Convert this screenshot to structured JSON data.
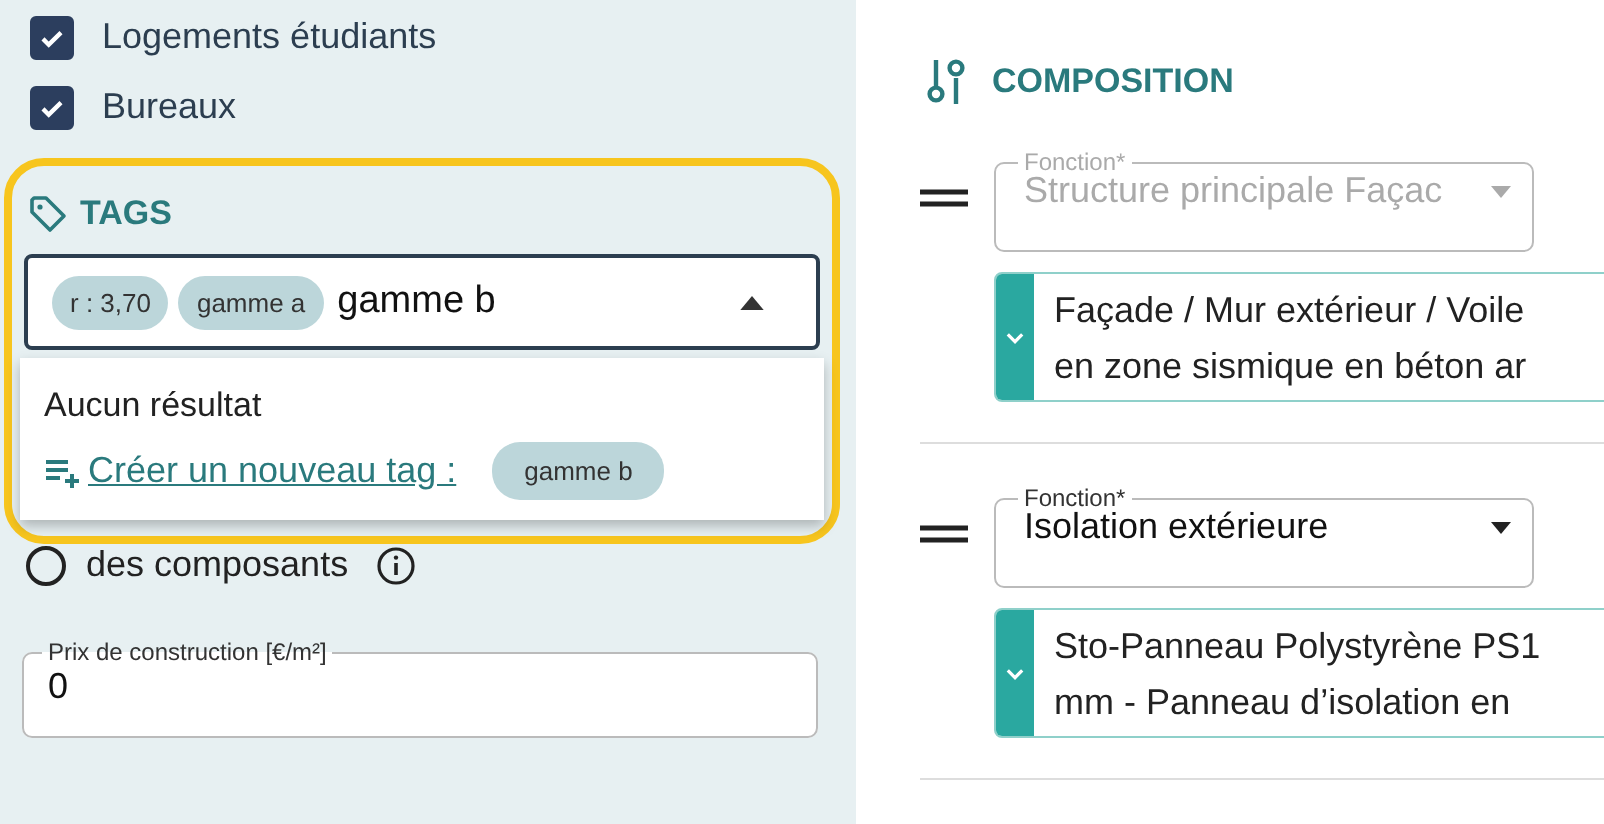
{
  "sidebar": {
    "checkboxes": [
      {
        "label": "Logements étudiants",
        "checked": true
      },
      {
        "label": "Bureaux",
        "checked": true
      }
    ],
    "tags": {
      "title": "TAGS",
      "chips": [
        "r : 3,70",
        "gamme a"
      ],
      "value": "gamme b",
      "expanded": true,
      "menu": {
        "empty_text": "Aucun résultat",
        "create_link": "Créer un nouveau tag :",
        "create_chip": "gamme b"
      }
    },
    "radio": {
      "label": "des composants",
      "selected": false
    },
    "price": {
      "label": "Prix de construction [€/m²]",
      "value": "0"
    }
  },
  "composition": {
    "title": "COMPOSITION",
    "rows": [
      {
        "field": {
          "label": "Fonction*",
          "value": "Structure principale Façac",
          "disabled": true
        },
        "card": {
          "lines": [
            "Façade / Mur extérieur / Voile",
            "en zone sismique en béton ar"
          ]
        }
      },
      {
        "field": {
          "label": "Fonction*",
          "value": "Isolation extérieure",
          "disabled": false
        },
        "card": {
          "lines": [
            "Sto-Panneau Polystyrène PS1",
            "mm - Panneau d’isolation en"
          ]
        }
      }
    ]
  }
}
